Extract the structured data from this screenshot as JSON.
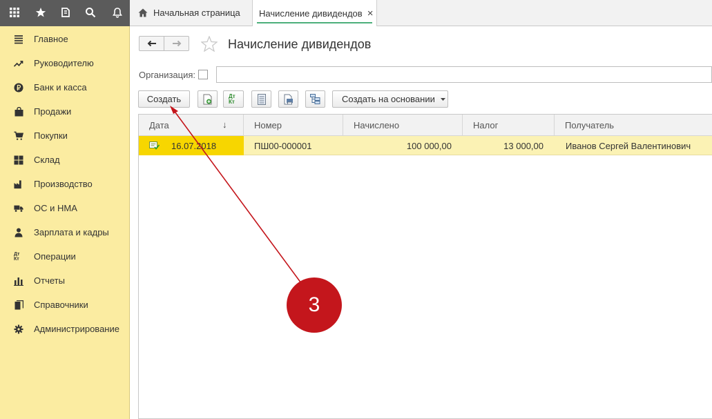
{
  "topbar": {
    "icons": [
      "apps-grid-icon",
      "favorites-star-icon",
      "history-icon",
      "search-icon",
      "notifications-bell-icon"
    ]
  },
  "tabs": [
    {
      "label": "Начальная страница",
      "icon": "home-icon"
    },
    {
      "label": "Начисление дивидендов",
      "close": "×"
    }
  ],
  "sidebar": {
    "items": [
      {
        "label": "Главное",
        "icon": "menu-lines-icon"
      },
      {
        "label": "Руководителю",
        "icon": "trend-up-icon"
      },
      {
        "label": "Банк и касса",
        "icon": "ruble-coin-icon"
      },
      {
        "label": "Продажи",
        "icon": "shopping-bag-icon"
      },
      {
        "label": "Покупки",
        "icon": "cart-icon"
      },
      {
        "label": "Склад",
        "icon": "warehouse-grid-icon"
      },
      {
        "label": "Производство",
        "icon": "factory-icon"
      },
      {
        "label": "ОС и НМА",
        "icon": "truck-icon"
      },
      {
        "label": "Зарплата и кадры",
        "icon": "person-icon"
      },
      {
        "label": "Операции",
        "icon": "debit-credit-icon"
      },
      {
        "label": "Отчеты",
        "icon": "bar-chart-icon"
      },
      {
        "label": "Справочники",
        "icon": "books-icon"
      },
      {
        "label": "Администрирование",
        "icon": "gear-icon"
      }
    ],
    "dtkt_text": "Дт Кт"
  },
  "page": {
    "title": "Начисление дивидендов",
    "org_label": "Организация:",
    "org_value": ""
  },
  "toolbar": {
    "create_label": "Создать",
    "dtkt_label": "Дт Кт",
    "create_based_label": "Создать на основании"
  },
  "table": {
    "columns": [
      "Дата",
      "Номер",
      "Начислено",
      "Налог",
      "Получатель"
    ],
    "sort_indicator": "↓",
    "rows": [
      {
        "date": "16.07.2018",
        "number": "ПШ00-000001",
        "accrued": "100 000,00",
        "tax": "13 000,00",
        "recipient": "Иванов Сергей Валентинович"
      }
    ]
  },
  "annotation": {
    "badge_number": "3",
    "color": "#c4161c"
  },
  "colors": {
    "sidebar_bg": "#fbeca1",
    "selected_row": "#fbf2b4",
    "selected_cell": "#f7d600",
    "topbar_bg": "#5b5b5b"
  }
}
